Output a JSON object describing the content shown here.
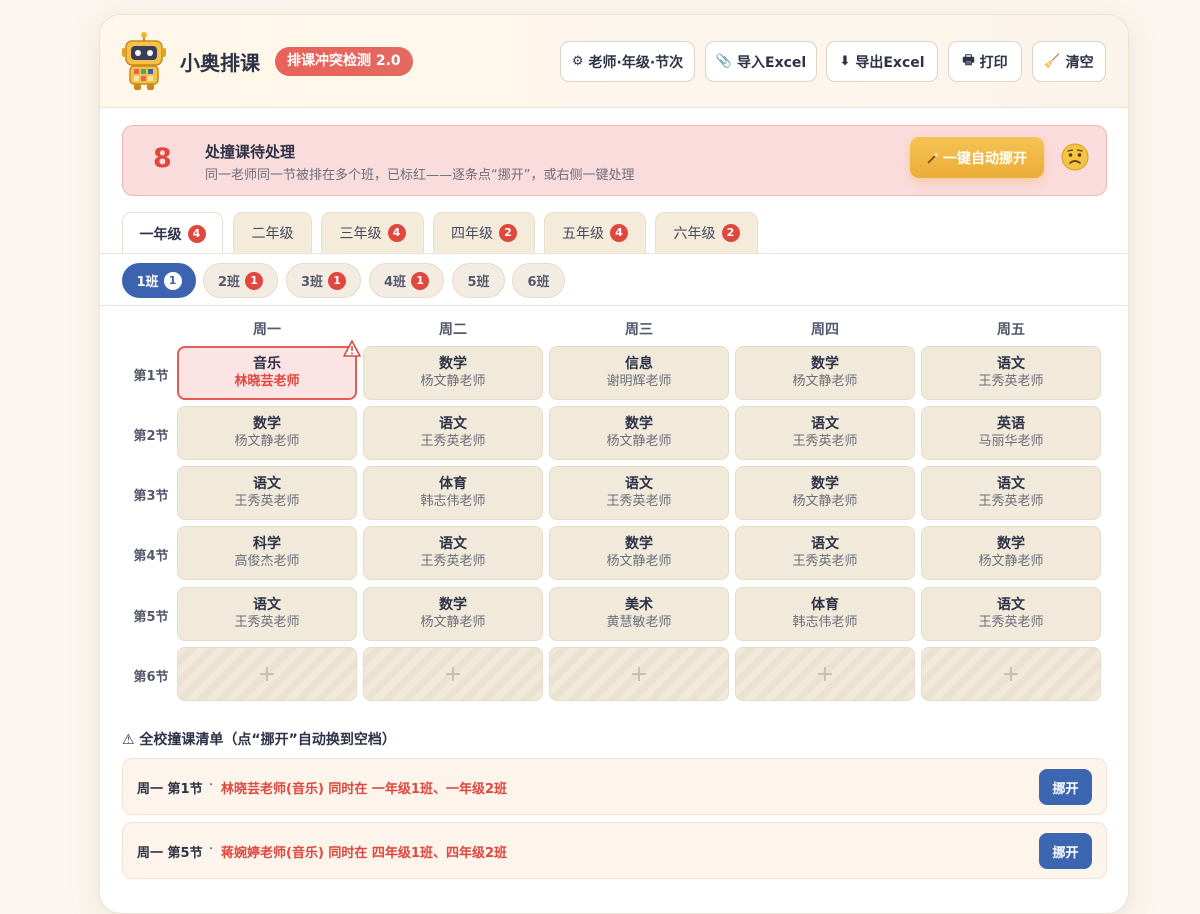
{
  "header": {
    "app_title": "小奥排课",
    "version_badge": "排课冲突检测 2.0",
    "mascot_text": "aoyi",
    "buttons": [
      {
        "icon": "gear-icon",
        "glyph": "⚙",
        "label": "老师·年级·节次"
      },
      {
        "icon": "paperclip-icon",
        "glyph": "📎",
        "label": "导入Excel"
      },
      {
        "icon": "download-icon",
        "glyph": "⬇",
        "label": "导出Excel"
      },
      {
        "icon": "printer-icon",
        "glyph": "🖶",
        "label": "打印"
      },
      {
        "icon": "broom-icon",
        "glyph": "🧹",
        "label": "清空"
      }
    ]
  },
  "alert": {
    "count": "8",
    "title": "处撞课待处理",
    "description": "同一老师同一节被排在多个班，已标红——逐条点“挪开”，或右侧一键处理",
    "auto_button": "一键自动挪开",
    "auto_icon": "magic-wand-icon",
    "face_icon": "worried-face-icon"
  },
  "grade_tabs": [
    {
      "label": "一年级",
      "count": "4",
      "active": true
    },
    {
      "label": "二年级",
      "count": "",
      "active": false
    },
    {
      "label": "三年级",
      "count": "4",
      "active": false
    },
    {
      "label": "四年级",
      "count": "2",
      "active": false
    },
    {
      "label": "五年级",
      "count": "4",
      "active": false
    },
    {
      "label": "六年级",
      "count": "2",
      "active": false
    }
  ],
  "class_tabs": [
    {
      "label": "1班",
      "count": "1",
      "active": true
    },
    {
      "label": "2班",
      "count": "1",
      "active": false
    },
    {
      "label": "3班",
      "count": "1",
      "active": false
    },
    {
      "label": "4班",
      "count": "1",
      "active": false
    },
    {
      "label": "5班",
      "count": "",
      "active": false
    },
    {
      "label": "6班",
      "count": "",
      "active": false
    }
  ],
  "timetable": {
    "days": [
      "周一",
      "周二",
      "周三",
      "周四",
      "周五"
    ],
    "periods": [
      "第1节",
      "第2节",
      "第3节",
      "第4节",
      "第5节",
      "第6节"
    ],
    "empty_glyph": "+",
    "cells": [
      [
        {
          "subject": "音乐",
          "teacher": "林晓芸老师",
          "conflict": true
        },
        {
          "subject": "数学",
          "teacher": "杨文静老师"
        },
        {
          "subject": "信息",
          "teacher": "谢明辉老师"
        },
        {
          "subject": "数学",
          "teacher": "杨文静老师"
        },
        {
          "subject": "语文",
          "teacher": "王秀英老师"
        }
      ],
      [
        {
          "subject": "数学",
          "teacher": "杨文静老师"
        },
        {
          "subject": "语文",
          "teacher": "王秀英老师"
        },
        {
          "subject": "数学",
          "teacher": "杨文静老师"
        },
        {
          "subject": "语文",
          "teacher": "王秀英老师"
        },
        {
          "subject": "英语",
          "teacher": "马丽华老师"
        }
      ],
      [
        {
          "subject": "语文",
          "teacher": "王秀英老师"
        },
        {
          "subject": "体育",
          "teacher": "韩志伟老师"
        },
        {
          "subject": "语文",
          "teacher": "王秀英老师"
        },
        {
          "subject": "数学",
          "teacher": "杨文静老师"
        },
        {
          "subject": "语文",
          "teacher": "王秀英老师"
        }
      ],
      [
        {
          "subject": "科学",
          "teacher": "高俊杰老师"
        },
        {
          "subject": "语文",
          "teacher": "王秀英老师"
        },
        {
          "subject": "数学",
          "teacher": "杨文静老师"
        },
        {
          "subject": "语文",
          "teacher": "王秀英老师"
        },
        {
          "subject": "数学",
          "teacher": "杨文静老师"
        }
      ],
      [
        {
          "subject": "语文",
          "teacher": "王秀英老师"
        },
        {
          "subject": "数学",
          "teacher": "杨文静老师"
        },
        {
          "subject": "美术",
          "teacher": "黄慧敏老师"
        },
        {
          "subject": "体育",
          "teacher": "韩志伟老师"
        },
        {
          "subject": "语文",
          "teacher": "王秀英老师"
        }
      ],
      [
        {
          "subject": "",
          "teacher": "",
          "empty": true
        },
        {
          "subject": "",
          "teacher": "",
          "empty": true
        },
        {
          "subject": "",
          "teacher": "",
          "empty": true
        },
        {
          "subject": "",
          "teacher": "",
          "empty": true
        },
        {
          "subject": "",
          "teacher": "",
          "empty": true
        }
      ]
    ]
  },
  "conflict_list": {
    "title": "⚠ 全校撞课清单（点“挪开”自动换到空档）",
    "items": [
      {
        "slot": "周一 第1节",
        "separator": "·",
        "detail": "林晓芸老师(音乐) 同时在 一年级1班、一年级2班",
        "button": "挪开"
      },
      {
        "slot": "周一 第5节",
        "separator": "·",
        "detail": "蒋婉婷老师(音乐) 同时在 四年级1班、四年级2班",
        "button": "挪开"
      }
    ]
  },
  "colors": {
    "accent_blue": "#3c63b0",
    "conflict_red": "#e0473f",
    "warning_gold": "#ecac37",
    "cell_bg": "#f1e9da"
  }
}
